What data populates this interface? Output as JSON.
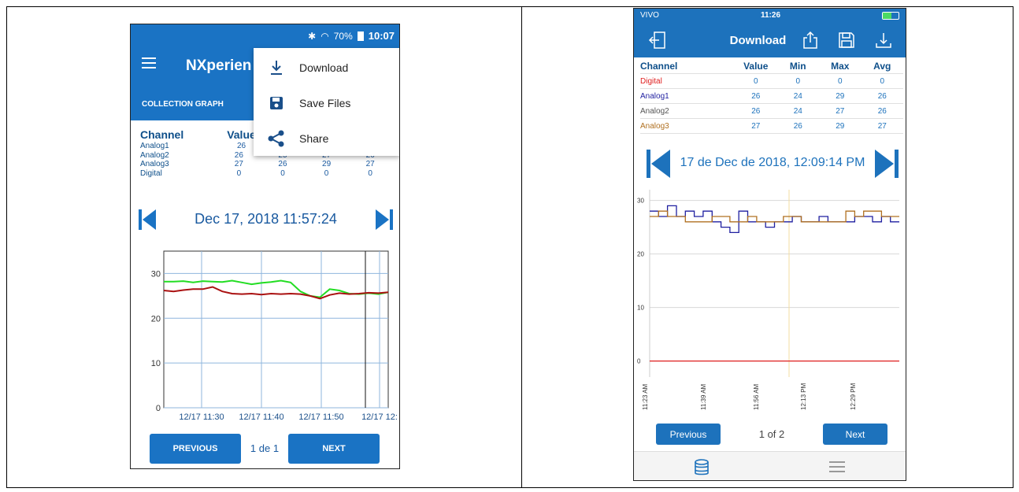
{
  "android": {
    "status": {
      "battery": "70%",
      "time": "10:07"
    },
    "app_title": "NXperience",
    "tab_label": "COLLECTION GRAPH",
    "menu": [
      {
        "label": "Download",
        "icon": "download-icon"
      },
      {
        "label": "Save Files",
        "icon": "save-icon"
      },
      {
        "label": "Share",
        "icon": "share-icon"
      }
    ],
    "table": {
      "headers": [
        "Channel",
        "Value",
        "",
        "",
        ""
      ],
      "rows": [
        {
          "channel": "Analog1",
          "values": [
            "26",
            "",
            "",
            ""
          ]
        },
        {
          "channel": "Analog2",
          "values": [
            "26",
            "25",
            "27",
            "26"
          ]
        },
        {
          "channel": "Analog3",
          "values": [
            "27",
            "26",
            "29",
            "27"
          ]
        },
        {
          "channel": "Digital",
          "values": [
            "0",
            "0",
            "0",
            "0"
          ]
        }
      ]
    },
    "date": "Dec 17, 2018 11:57:24",
    "pagination": {
      "previous": "PREVIOUS",
      "page": "1 de 1",
      "next": "NEXT"
    },
    "colors": {
      "primary": "#1a73c4",
      "green": "#22dd22",
      "red": "#aa1111"
    }
  },
  "ios": {
    "status": {
      "carrier": "VIVO",
      "time": "11:26"
    },
    "title": "Download",
    "header_icons": [
      "logout-icon",
      "share-icon",
      "save-icon",
      "download-icon"
    ],
    "table": {
      "headers": [
        "Channel",
        "Value",
        "Min",
        "Max",
        "Avg"
      ],
      "rows": [
        {
          "channel": "Digital",
          "color": "#e02020",
          "values": [
            "0",
            "0",
            "0",
            "0"
          ]
        },
        {
          "channel": "Analog1",
          "color": "#1f1fa0",
          "values": [
            "26",
            "24",
            "29",
            "26"
          ]
        },
        {
          "channel": "Analog2",
          "color": "#555555",
          "values": [
            "26",
            "24",
            "27",
            "26"
          ]
        },
        {
          "channel": "Analog3",
          "color": "#b07020",
          "values": [
            "27",
            "26",
            "29",
            "27"
          ]
        }
      ]
    },
    "date": "17 de Dec de 2018, 12:09:14 PM",
    "pagination": {
      "previous": "Previous",
      "page": "1 of 2",
      "next": "Next"
    },
    "tabbar": [
      "database-icon",
      "menu-icon"
    ],
    "colors": {
      "primary": "#1d72bc"
    }
  },
  "chart_data": [
    {
      "type": "line",
      "title": "",
      "xlabel": "",
      "ylabel": "",
      "x_ticks": [
        "12/17 11:30",
        "12/17 11:40",
        "12/17 11:50",
        "12/17 12:"
      ],
      "y_ticks": [
        0,
        10,
        20,
        30
      ],
      "ylim": [
        0,
        35
      ],
      "grid": true,
      "series": [
        {
          "color": "#22dd22",
          "values": [
            28.2,
            28.2,
            28.3,
            28.0,
            28.3,
            28.2,
            28.1,
            28.4,
            28.0,
            27.6,
            27.9,
            28.1,
            28.4,
            28.0,
            26.0,
            25.0,
            24.7,
            26.5,
            26.2,
            25.5,
            25.4,
            25.6,
            25.4,
            25.8
          ]
        },
        {
          "color": "#aa1111",
          "values": [
            26.2,
            26.0,
            26.3,
            26.5,
            26.5,
            27.0,
            26.0,
            25.5,
            25.4,
            25.5,
            25.3,
            25.5,
            25.4,
            25.5,
            25.4,
            25.0,
            24.4,
            25.2,
            25.6,
            25.4,
            25.5,
            25.7,
            25.6,
            25.8
          ]
        }
      ]
    },
    {
      "type": "line",
      "title": "",
      "xlabel": "",
      "ylabel": "",
      "x_ticks": [
        "11:23 AM",
        "11:39 AM",
        "11:56 AM",
        "12:13 PM",
        "12:29 PM"
      ],
      "y_ticks": [
        0,
        10,
        20,
        30
      ],
      "ylim": [
        -3,
        32
      ],
      "grid": true,
      "series": [
        {
          "color": "#e02020",
          "values": [
            0,
            0,
            0,
            0,
            0,
            0,
            0,
            0,
            0,
            0,
            0,
            0,
            0,
            0,
            0,
            0,
            0,
            0,
            0,
            0,
            0,
            0,
            0,
            0,
            0,
            0,
            0,
            0
          ]
        },
        {
          "color": "#1f1fa0",
          "values": [
            28,
            27,
            29,
            27,
            28,
            27,
            28,
            26,
            25,
            24,
            28,
            26,
            26,
            25,
            26,
            26,
            27,
            26,
            26,
            27,
            26,
            26,
            26,
            27,
            27,
            26,
            27,
            26
          ]
        },
        {
          "color": "#b07020",
          "values": [
            27,
            28,
            27,
            27,
            26,
            26,
            26,
            27,
            27,
            26,
            26,
            27,
            26,
            26,
            26,
            27,
            27,
            26,
            26,
            26,
            26,
            26,
            28,
            27,
            28,
            28,
            27,
            27
          ]
        }
      ]
    }
  ]
}
